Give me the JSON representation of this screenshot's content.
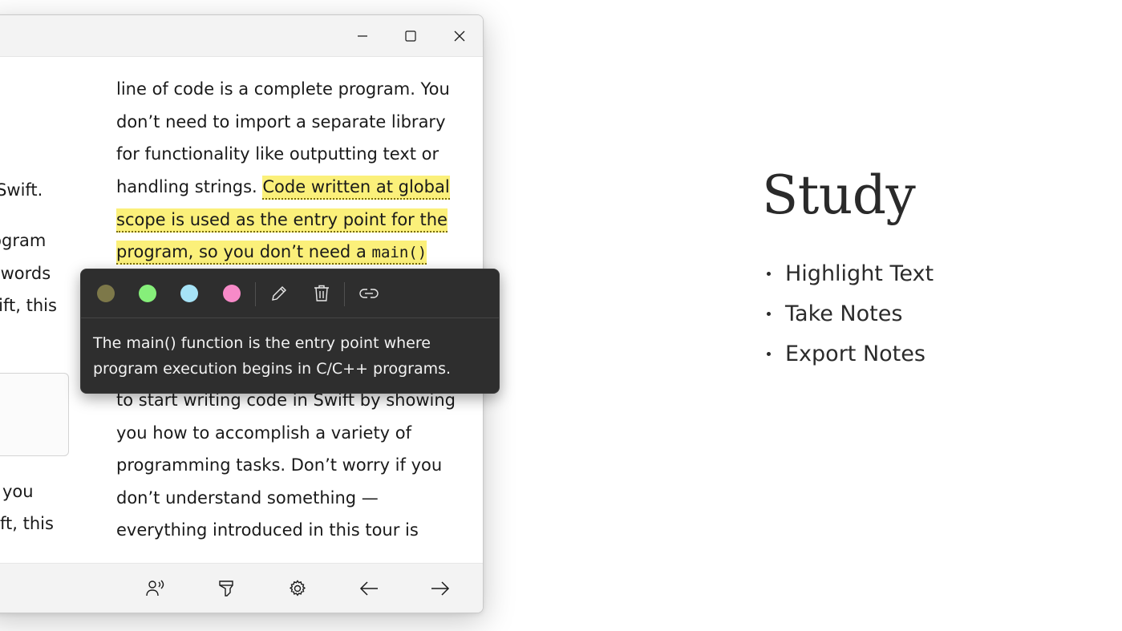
{
  "window": {
    "titlebar": {
      "minimize_glyph": "minimize-icon",
      "maximize_glyph": "maximize-icon",
      "close_glyph": "close-icon"
    },
    "left_fragments": [
      "f Swift.",
      "rogram",
      "e words",
      "wift, this",
      "you",
      "ft, this"
    ],
    "article": {
      "lines": [
        "line of code is a complete program. You",
        "don’t need to import a separate library",
        "for functionality like outputting text or"
      ],
      "line4_plain": "handling strings. ",
      "line4_highlight": "Code written at global",
      "line5_highlight": "scope is used as the entry point for the",
      "line6_highlight": "program, so you don’t need a ",
      "line6_code": "main()",
      "after_lines": [
        "to start writing code in Swift by showing",
        "you how to accomplish a variety of",
        "programming tasks. Don’t worry if you",
        "don’t understand something —",
        "everything introduced in this tour is"
      ]
    },
    "popup": {
      "swatches": [
        {
          "name": "olive",
          "color": "#7d7849"
        },
        {
          "name": "green",
          "color": "#86ef7a"
        },
        {
          "name": "blue",
          "color": "#a6e3f7"
        },
        {
          "name": "pink",
          "color": "#f78ac8"
        }
      ],
      "note": "The main() function is the entry point where program execution begins in C/C++ programs."
    },
    "bottombar": {
      "icons": [
        "read-aloud-icon",
        "highlighter-icon",
        "settings-icon",
        "arrow-left-icon",
        "arrow-right-icon"
      ]
    }
  },
  "promo": {
    "title": "Study",
    "features": [
      "Highlight Text",
      "Take Notes",
      "Export Notes"
    ]
  },
  "colors": {
    "highlight": "#fbf07a",
    "popup_bg": "#2e2e2e"
  }
}
